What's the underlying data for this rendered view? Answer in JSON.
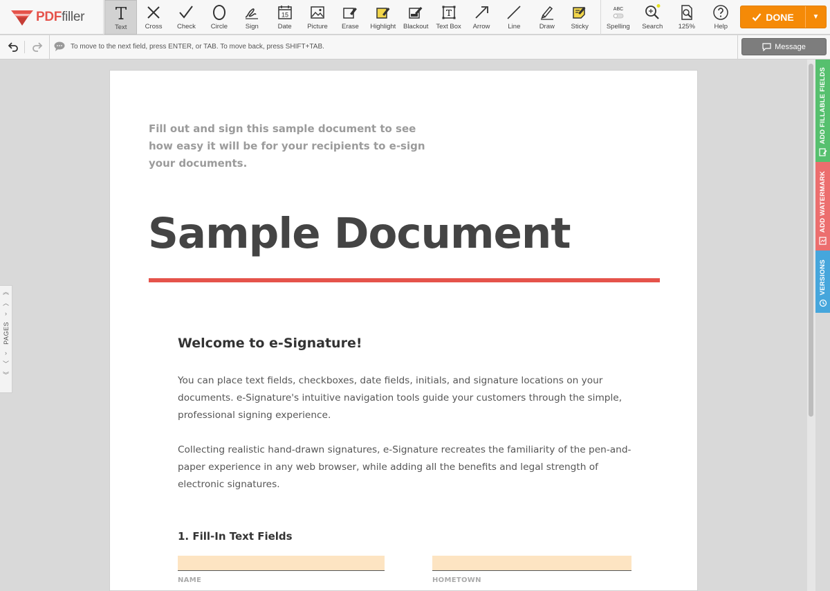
{
  "app": {
    "logo_pdf": "PDF",
    "logo_filler": "filler",
    "brand_color": "#e5534b"
  },
  "toolbar": {
    "tools": [
      {
        "label": "Text",
        "icon": "text-icon"
      },
      {
        "label": "Cross",
        "icon": "cross-icon"
      },
      {
        "label": "Check",
        "icon": "check-icon"
      },
      {
        "label": "Circle",
        "icon": "circle-icon"
      },
      {
        "label": "Sign",
        "icon": "sign-icon"
      },
      {
        "label": "Date",
        "icon": "calendar-icon",
        "date_number": "15"
      },
      {
        "label": "Picture",
        "icon": "picture-icon"
      },
      {
        "label": "Erase",
        "icon": "eraser-icon"
      },
      {
        "label": "Highlight",
        "icon": "highlight-icon"
      },
      {
        "label": "Blackout",
        "icon": "blackout-icon"
      },
      {
        "label": "Text Box",
        "icon": "text-box-icon"
      },
      {
        "label": "Arrow",
        "icon": "arrow-icon"
      },
      {
        "label": "Line",
        "icon": "line-icon"
      },
      {
        "label": "Draw",
        "icon": "draw-icon"
      },
      {
        "label": "Sticky",
        "icon": "sticky-icon"
      }
    ],
    "active_tool": "Text",
    "right_tools": [
      {
        "label": "Spelling",
        "icon": "spelling-icon",
        "icon_text": "ABC"
      },
      {
        "label": "Search",
        "icon": "search-icon"
      },
      {
        "label": "125%",
        "icon": "zoom-icon"
      },
      {
        "label": "Help",
        "icon": "help-icon"
      }
    ],
    "done_label": "DONE",
    "done_color": "#f58a07"
  },
  "subbar": {
    "hint": "To move to the next field, press ENTER, or TAB. To move back, press SHIFT+TAB.",
    "message_label": "Message"
  },
  "pages_tab": {
    "label": "PAGES"
  },
  "side_tabs": [
    {
      "label": "ADD FILLABLE FIELDS",
      "color": "#56c06e"
    },
    {
      "label": "ADD WATERMARK",
      "color": "#ec6e6e"
    },
    {
      "label": "VERSIONS",
      "color": "#46a6dc"
    }
  ],
  "document": {
    "intro": "Fill out and sign this sample document to see how easy it will be for your recipients to e-sign your documents.",
    "title": "Sample Document",
    "welcome": "Welcome to e-Signature!",
    "para1": "You can place text fields, checkboxes, date fields, initials, and signature locations on your documents. e-Signature's intuitive navigation tools guide your customers through the simple, professional signing experience.",
    "para2": "Collecting realistic hand-drawn signatures, e-Signature recreates the familiarity of the pen-and-paper experience in any web browser, while adding all the benefits and legal strength of electronic signatures.",
    "section1": "1. Fill-In Text Fields",
    "field_name_label": "NAME",
    "field_hometown_label": "HOMETOWN",
    "field_name_value": "",
    "field_hometown_value": ""
  }
}
